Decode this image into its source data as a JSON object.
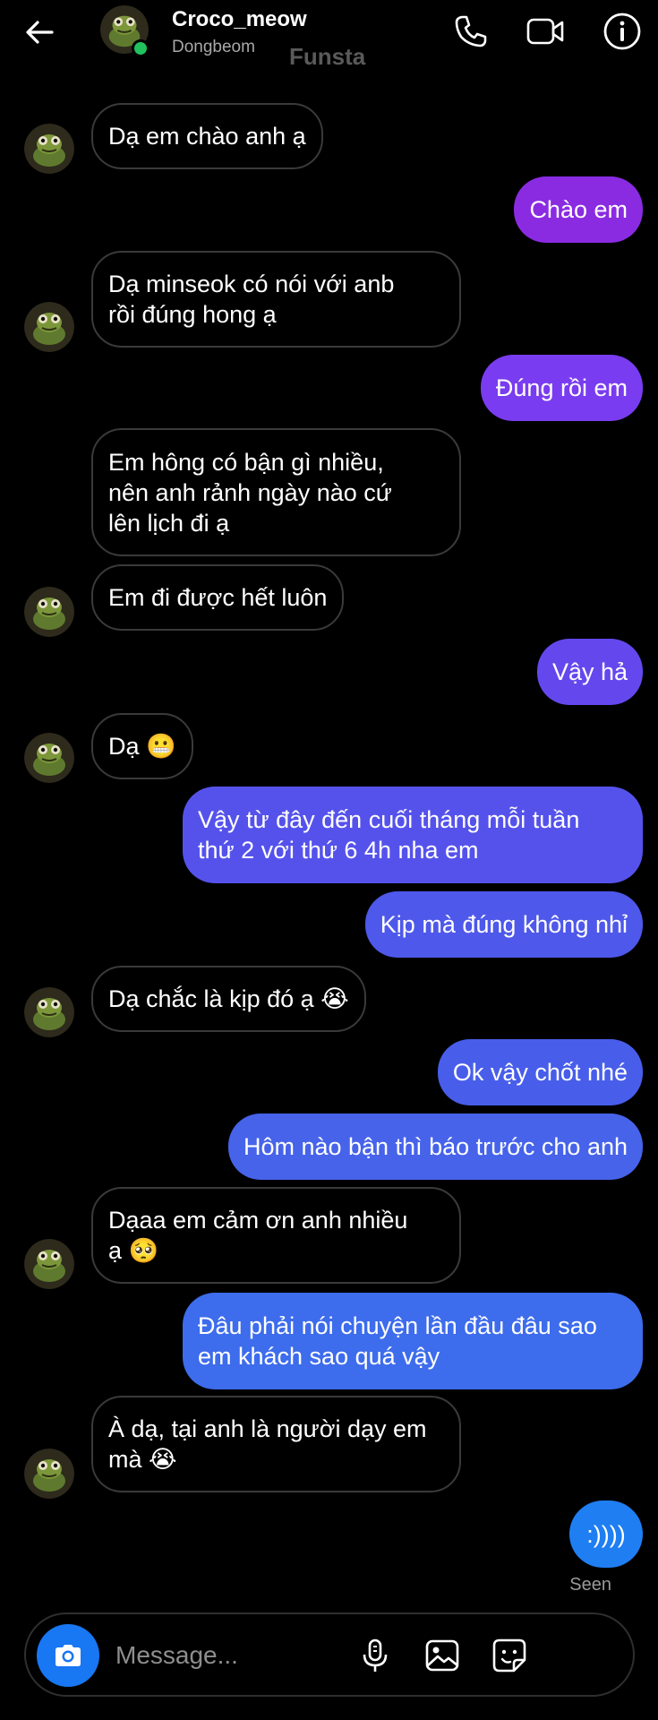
{
  "header": {
    "contact_name": "Croco_meow",
    "contact_subtitle": "Dongbeom",
    "watermark": "Funsta",
    "icons": [
      "back-arrow-icon",
      "phone-icon",
      "video-icon",
      "info-icon"
    ]
  },
  "messages": [
    {
      "side": "in",
      "avatar": true,
      "text": "Dạ em chào anh ạ"
    },
    {
      "side": "out",
      "text": "Chào em",
      "color": "#8a2be2"
    },
    {
      "side": "in",
      "avatar": true,
      "text": "Dạ minseok có nói với anb\nrồi đúng hong ạ"
    },
    {
      "side": "out",
      "text": "Đúng rồi em",
      "color": "#7a3cf0"
    },
    {
      "side": "in",
      "avatar": false,
      "text": "Em hông có bận gì nhiều,\nnên anh rảnh ngày nào cứ\nlên lịch đi ạ"
    },
    {
      "side": "in",
      "avatar": true,
      "text": "Em đi được hết luôn"
    },
    {
      "side": "out",
      "text": "Vậy hả",
      "color": "#6448ee"
    },
    {
      "side": "in",
      "avatar": true,
      "text": "Dạ 😬"
    },
    {
      "side": "out",
      "text": "Vậy từ đây đến cuối tháng mỗi tuần\nthứ 2 với thứ 6 4h nha em",
      "color": "#5552ec"
    },
    {
      "side": "out",
      "text": "Kịp mà đúng không nhỉ",
      "color": "#4e58ea"
    },
    {
      "side": "in",
      "avatar": true,
      "text": "Dạ chắc là kịp đó ạ 😭"
    },
    {
      "side": "out",
      "text": "Ok vậy chốt nhé",
      "color": "#485eea"
    },
    {
      "side": "out",
      "text": "Hôm nào bận thì báo trước cho anh",
      "color": "#4663ea"
    },
    {
      "side": "in",
      "avatar": true,
      "text": "Dạaa em cảm ơn anh nhiều\nạ 🥺"
    },
    {
      "side": "out",
      "text": "Đâu phải nói chuyện lần đầu đâu sao\nem khách sao quá vậy",
      "color": "#3d6cec"
    },
    {
      "side": "in",
      "avatar": true,
      "text": "À dạ, tại anh là người dạy em\nmà 😭"
    },
    {
      "side": "out",
      "text": ":))))",
      "color": "#1f7ef2"
    }
  ],
  "status": {
    "seen": "Seen"
  },
  "composer": {
    "placeholder": "Message...",
    "icons": [
      "camera-icon",
      "microphone-icon",
      "gallery-icon",
      "sticker-icon"
    ]
  },
  "colors": {
    "background": "#000000",
    "camera_button": "#1877f2",
    "online": "#21c25e"
  }
}
